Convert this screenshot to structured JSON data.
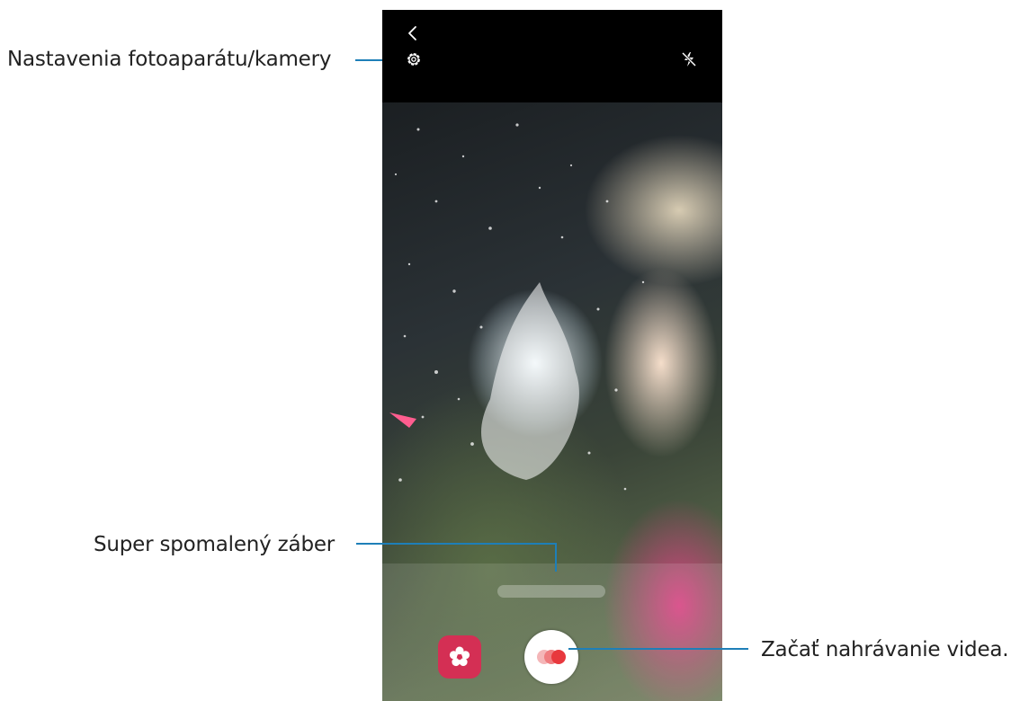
{
  "callouts": {
    "camera_settings": "Nastavenia fotoaparátu/kamery",
    "super_slow_mo": "Super spomalený záber",
    "start_recording": "Začať nahrávanie videa."
  },
  "icons": {
    "back": "chevron-left-icon",
    "settings": "gear-icon",
    "flash": "flash-off-icon",
    "gallery": "flower-icon",
    "record": "record-icon"
  },
  "colors": {
    "leader_line": "#1e7fb8",
    "gallery_button": "#d42f54",
    "record_dot": "#e8383d"
  }
}
